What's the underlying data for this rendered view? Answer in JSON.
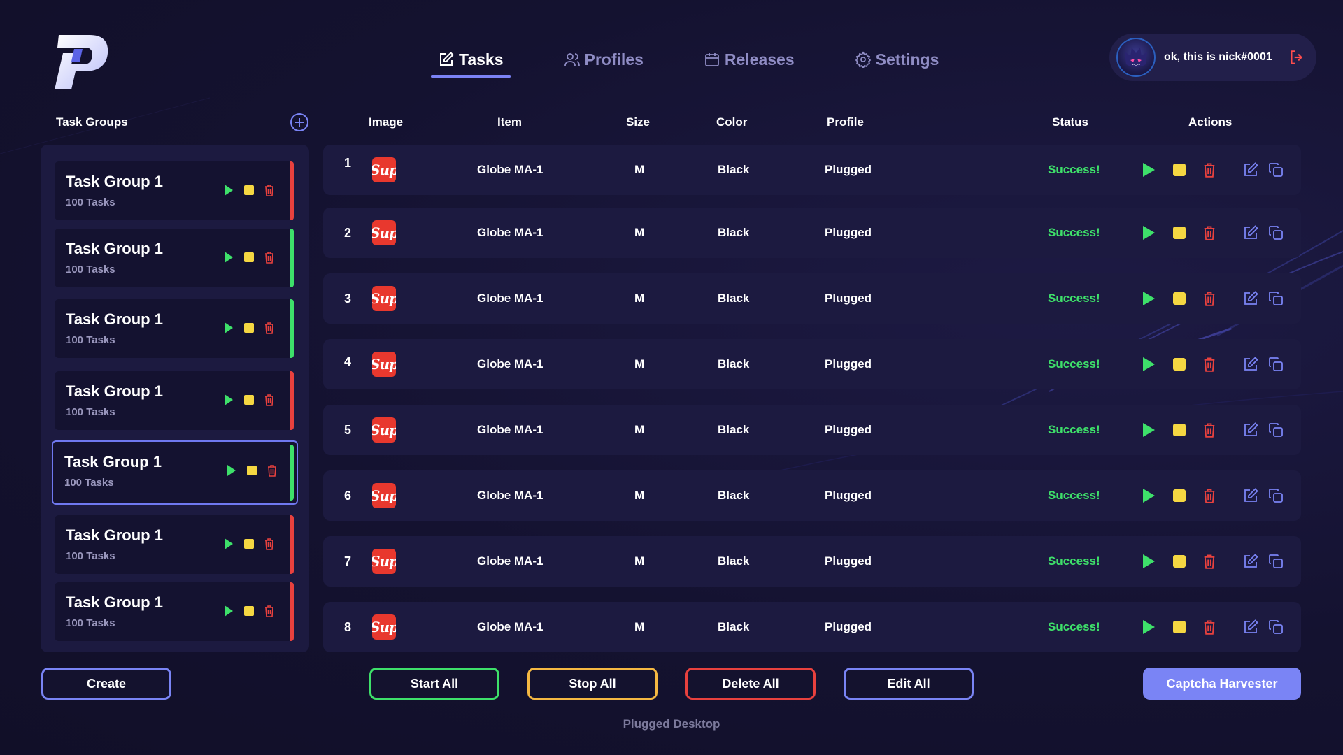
{
  "nav": {
    "tabs": [
      {
        "label": "Tasks",
        "icon": "edit-icon",
        "active": true
      },
      {
        "label": "Profiles",
        "icon": "users-icon",
        "active": false
      },
      {
        "label": "Releases",
        "icon": "calendar-icon",
        "active": false
      },
      {
        "label": "Settings",
        "icon": "gear-icon",
        "active": false
      }
    ]
  },
  "user": {
    "name": "ok, this is nick#0001",
    "avatar_icon": "ghost-avatar-icon",
    "logout_icon": "logout-icon"
  },
  "sidebar": {
    "title": "Task Groups",
    "add_icon": "plus-circle-icon",
    "groups": [
      {
        "name": "Task Group 1",
        "count": "100 Tasks",
        "accent": "#e8413e",
        "selected": false
      },
      {
        "name": "Task Group 1",
        "count": "100 Tasks",
        "accent": "#3ee06a",
        "selected": false
      },
      {
        "name": "Task Group 1",
        "count": "100 Tasks",
        "accent": "#3ee06a",
        "selected": false
      },
      {
        "name": "Task Group 1",
        "count": "100 Tasks",
        "accent": "#e8413e",
        "selected": false
      },
      {
        "name": "Task Group 1",
        "count": "100 Tasks",
        "accent": "#3ee06a",
        "selected": true
      },
      {
        "name": "Task Group 1",
        "count": "100 Tasks",
        "accent": "#e8413e",
        "selected": false
      },
      {
        "name": "Task Group 1",
        "count": "100 Tasks",
        "accent": "#e8413e",
        "selected": false
      }
    ],
    "create_label": "Create"
  },
  "table": {
    "headers": {
      "image": "Image",
      "item": "Item",
      "size": "Size",
      "color": "Color",
      "profile": "Profile",
      "status": "Status",
      "actions": "Actions"
    },
    "rows": [
      {
        "num": "1",
        "img": "Sup",
        "item": "Globe MA-1",
        "size": "M",
        "color": "Black",
        "profile": "Plugged",
        "status": "Success!"
      },
      {
        "num": "2",
        "img": "Sup",
        "item": "Globe MA-1",
        "size": "M",
        "color": "Black",
        "profile": "Plugged",
        "status": "Success!"
      },
      {
        "num": "3",
        "img": "Sup",
        "item": "Globe MA-1",
        "size": "M",
        "color": "Black",
        "profile": "Plugged",
        "status": "Success!"
      },
      {
        "num": "4",
        "img": "Sup",
        "item": "Globe MA-1",
        "size": "M",
        "color": "Black",
        "profile": "Plugged",
        "status": "Success!"
      },
      {
        "num": "5",
        "img": "Sup",
        "item": "Globe MA-1",
        "size": "M",
        "color": "Black",
        "profile": "Plugged",
        "status": "Success!"
      },
      {
        "num": "6",
        "img": "Sup",
        "item": "Globe MA-1",
        "size": "M",
        "color": "Black",
        "profile": "Plugged",
        "status": "Success!"
      },
      {
        "num": "7",
        "img": "Sup",
        "item": "Globe MA-1",
        "size": "M",
        "color": "Black",
        "profile": "Plugged",
        "status": "Success!"
      },
      {
        "num": "8",
        "img": "Sup",
        "item": "Globe MA-1",
        "size": "M",
        "color": "Black",
        "profile": "Plugged",
        "status": "Success!"
      }
    ]
  },
  "bulk": {
    "start": "Start All",
    "stop": "Stop All",
    "delete": "Delete All",
    "edit": "Edit All"
  },
  "captcha_label": "Captcha Harvester",
  "footer": "Plugged Desktop",
  "colors": {
    "accent": "#7a84f5",
    "success": "#3ee06a",
    "danger": "#e8413e",
    "warning": "#f5c542",
    "bg": "#14122e",
    "panel": "#1c1a40"
  }
}
